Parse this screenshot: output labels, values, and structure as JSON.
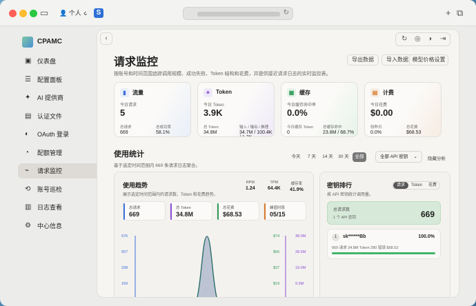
{
  "browser": {
    "profile": "个人",
    "favicon_letter": "S"
  },
  "sidebar": {
    "brand": "CPAMC",
    "items": [
      {
        "label": "仪表盘",
        "icon": "dashboard-icon",
        "glyph": "▣"
      },
      {
        "label": "配置面板",
        "icon": "sliders-icon",
        "glyph": "☰"
      },
      {
        "label": "AI 提供商",
        "icon": "ai-icon",
        "glyph": "✦"
      },
      {
        "label": "认证文件",
        "icon": "file-icon",
        "glyph": "▤"
      },
      {
        "label": "OAuth 登录",
        "icon": "shield-icon",
        "glyph": "◐"
      },
      {
        "label": "配额管理",
        "icon": "quota-icon",
        "glyph": "◔"
      },
      {
        "label": "请求监控",
        "icon": "monitor-icon",
        "glyph": "⌁"
      },
      {
        "label": "账号巡检",
        "icon": "inspect-icon",
        "glyph": "⟲"
      },
      {
        "label": "日志查看",
        "icon": "log-icon",
        "glyph": "▥"
      },
      {
        "label": "中心信息",
        "icon": "info-icon",
        "glyph": "⚙"
      }
    ],
    "active_index": 6
  },
  "header": {
    "title": "请求监控",
    "subtitle": "按账号和时间范围追踪调用规模、成功失败、Token 结构和花费，并提供接近请求日志的实时监控表。",
    "buttons": [
      "导出数据",
      "导入数据",
      "模型价格设置"
    ]
  },
  "cards": [
    {
      "name": "流量",
      "color": "#3b6fd8",
      "bg": "#e9eef9",
      "glyph": "▮",
      "label": "今日请求",
      "value": "5",
      "sub": [
        {
          "l": "总请求",
          "v": "669"
        },
        {
          "l": "总成功率",
          "v": "58.1%"
        }
      ]
    },
    {
      "name": "Token",
      "color": "#8a4fd6",
      "bg": "#efe9f8",
      "glyph": "✦",
      "label": "今日 Token",
      "value": "3.9K",
      "sub": [
        {
          "l": "总 Token",
          "v": "34.8M"
        },
        {
          "l": "输入 / 输出 / 推理",
          "v": "34.7M / 100.4K / 1.3K"
        }
      ]
    },
    {
      "name": "缓存",
      "color": "#2f9a57",
      "bg": "#e6f3e9",
      "glyph": "▦",
      "label": "今日缓存命中率",
      "value": "0.0%",
      "sub": [
        {
          "l": "今日缓存 Token",
          "v": "0"
        },
        {
          "l": "总缓存命中",
          "v": "23.8M / 68.7%"
        }
      ]
    },
    {
      "name": "计费",
      "color": "#d97a2b",
      "bg": "#f7ece2",
      "glyph": "▤",
      "label": "今日花费",
      "value": "$0.00",
      "sub": [
        {
          "l": "较昨日",
          "v": "0.0%"
        },
        {
          "l": "总花费",
          "v": "$68.53"
        }
      ]
    }
  ],
  "usage": {
    "title": "使用统计",
    "subtitle": "基于选定时间范围内 669 条请求日志聚合。",
    "ranges": [
      "今天",
      "7 天",
      "14 天",
      "30 天",
      "全部"
    ],
    "active_range": 4,
    "select": "全部 API 密钥",
    "hide": "隐藏分析"
  },
  "trend": {
    "title": "使用趋势",
    "subtitle": "展示选定时间范围内的请求数、Token 和花费趋势。",
    "minis": [
      {
        "l": "RPM",
        "v": "1.24"
      },
      {
        "l": "TPM",
        "v": "64.4K"
      },
      {
        "l": "缓存率",
        "v": "41.9%"
      }
    ],
    "kpis": [
      {
        "l": "总请求",
        "v": "669",
        "c": "#3b6fd8"
      },
      {
        "l": "总 Token",
        "v": "34.8M",
        "c": "#8a4fd6"
      },
      {
        "l": "总花费",
        "v": "$68.53",
        "c": "#2f9a57"
      },
      {
        "l": "峰值时段",
        "v": "05/15",
        "c": "#d97a2b"
      }
    ],
    "left_ticks": [
      "676",
      "507",
      "338",
      "169"
    ],
    "mid_ticks": [
      "$74",
      "$56",
      "$37",
      "$19"
    ],
    "right_ticks": [
      "38.0M",
      "28.5M",
      "19.0M",
      "9.5M"
    ]
  },
  "chart_data": {
    "type": "area",
    "title": "使用趋势",
    "series": [
      {
        "values": [
          0,
          0,
          0,
          669,
          0,
          0,
          0
        ]
      }
    ],
    "ylim": [
      0,
      676
    ],
    "y_ticks": [
      169,
      338,
      507,
      676
    ]
  },
  "ranking": {
    "title": "密钥排行",
    "subtitle": "按 API 密钥统计调用量。",
    "tabs": [
      "请求",
      "Token",
      "花费"
    ],
    "active_tab": 0,
    "total_label": "总请求数",
    "total_sub": "1 个 API 密钥",
    "total_value": "669",
    "row": {
      "rank": "1",
      "name": "sk******Bb",
      "pct": "100.0%",
      "detail": "669 请求   34.8M Token   280 错误   $68.53",
      "progress": 1.0
    }
  }
}
